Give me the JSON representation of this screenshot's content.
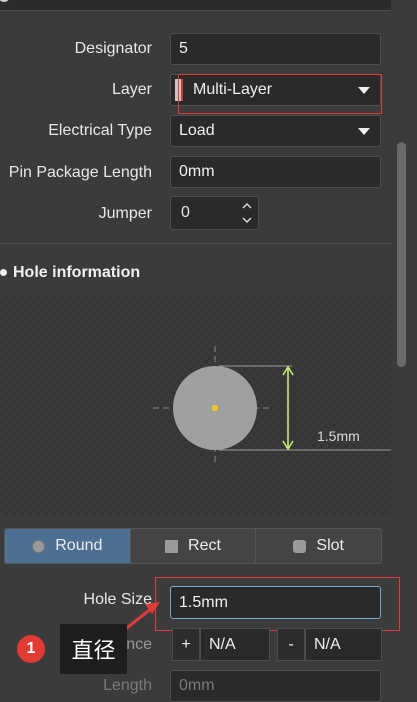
{
  "properties": {
    "designator": {
      "label": "Designator",
      "value": "5"
    },
    "layer": {
      "label": "Layer",
      "value": "Multi-Layer"
    },
    "electrical_type": {
      "label": "Electrical Type",
      "value": "Load"
    },
    "pin_package_length": {
      "label": "Pin Package Length",
      "value": "0mm"
    },
    "jumper": {
      "label": "Jumper",
      "value": "0"
    }
  },
  "hole_information": {
    "title": "Hole information",
    "preview_dimension": "1.5mm",
    "shapes": [
      "Round",
      "Rect",
      "Slot"
    ],
    "selected_shape": "Round",
    "hole_size": {
      "label": "Hole Size",
      "value": "1.5mm"
    },
    "tolerance": {
      "label": "ance",
      "plus_symbol": "+",
      "plus_value": "N/A",
      "minus_symbol": "-",
      "minus_value": "N/A"
    },
    "length": {
      "label": "Length",
      "value": "0mm"
    }
  },
  "annotation": {
    "badge": "1",
    "text": "直径"
  },
  "colors": {
    "accent_selected": "#4d6f93",
    "highlight_red": "#e03b3b",
    "drill_center": "#f3c623"
  }
}
